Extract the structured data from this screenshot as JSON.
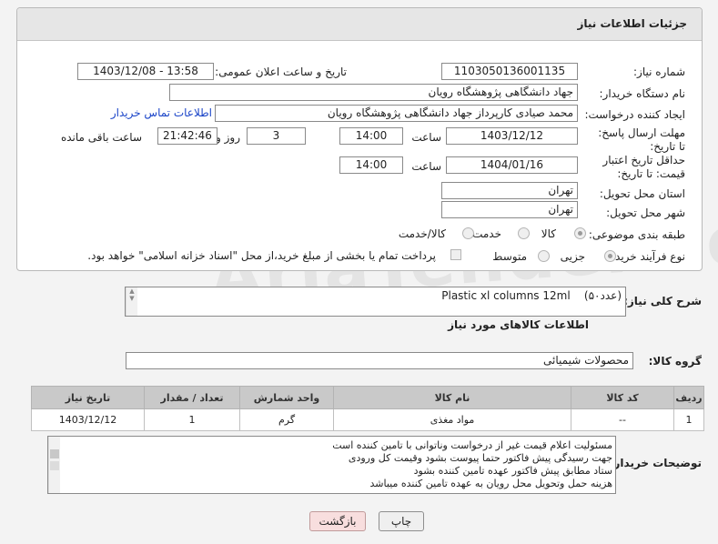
{
  "panel": {
    "title": "جزئیات اطلاعات نیاز"
  },
  "fields": {
    "need_number_label": "شماره نیاز:",
    "need_number": "1103050136001135",
    "announce_label": "تاریخ و ساعت اعلان عمومی:",
    "announce_value": "1403/12/08 - 13:58",
    "buyer_org_label": "نام دستگاه خریدار:",
    "buyer_org": "جهاد دانشگاهی پژوهشگاه رویان",
    "creator_label": "ایجاد کننده درخواست:",
    "creator": "محمد صیادی کارپرداز جهاد دانشگاهی پژوهشگاه رویان",
    "contact_link": "اطلاعات تماس خریدار",
    "deadline_label": "مهلت ارسال پاسخ: تا تاریخ:",
    "deadline_date": "1403/12/12",
    "time_label": "ساعت",
    "deadline_time": "14:00",
    "days_value": "3",
    "days_label": "روز و",
    "remaining_time": "21:42:46",
    "remaining_label": "ساعت باقی مانده",
    "validity_label": "حداقل تاریخ اعتبار قیمت: تا تاریخ:",
    "validity_date": "1404/01/16",
    "validity_time": "14:00",
    "province_label": "استان محل تحویل:",
    "province": "تهران",
    "city_label": "شهر محل تحویل:",
    "city": "تهران",
    "category_label": "طبقه بندی موضوعی:",
    "category_options": [
      "کالا",
      "خدمت",
      "کالا/خدمت"
    ],
    "process_label": "نوع فرآیند خرید :",
    "process_options": [
      "جزیی",
      "متوسط"
    ],
    "payment_note": "پرداخت تمام یا بخشی از مبلغ خرید،از محل \"اسناد خزانه اسلامی\" خواهد بود."
  },
  "description": {
    "label": "شرح کلی نیاز:",
    "text": "Plastic xl columns 12ml    (۵۰عدد)"
  },
  "goods": {
    "section_title": "اطلاعات کالاهای مورد نیاز",
    "group_label": "گروه کالا:",
    "group": "محصولات شیمیائی",
    "columns": [
      "ردیف",
      "کد کالا",
      "نام کالا",
      "واحد شمارش",
      "تعداد / مقدار",
      "تاریخ نیاز"
    ],
    "rows": [
      [
        "1",
        "--",
        "مواد مغذی",
        "گرم",
        "1",
        "1403/12/12"
      ]
    ]
  },
  "buyer_notes": {
    "label": "توضیحات خریدار:",
    "lines": [
      "مسئولیت اعلام قیمت  غیر از درخواست وناتوانی با تامین کننده است",
      "جهت رسیدگی پیش فاکتور حتما پیوست بشود وقیمت کل ورودی",
      "ستاد مطابق پیش فاکتور عهده تامین کننده بشود",
      "هزینه حمل وتحویل محل رویان به عهده تامین کننده میباشد"
    ]
  },
  "buttons": {
    "print": "چاپ",
    "back": "بازگشت"
  },
  "watermark": "AriaTender.neT",
  "colors": {
    "link": "#1a44c8",
    "back_button_bg": "#f8dede"
  }
}
